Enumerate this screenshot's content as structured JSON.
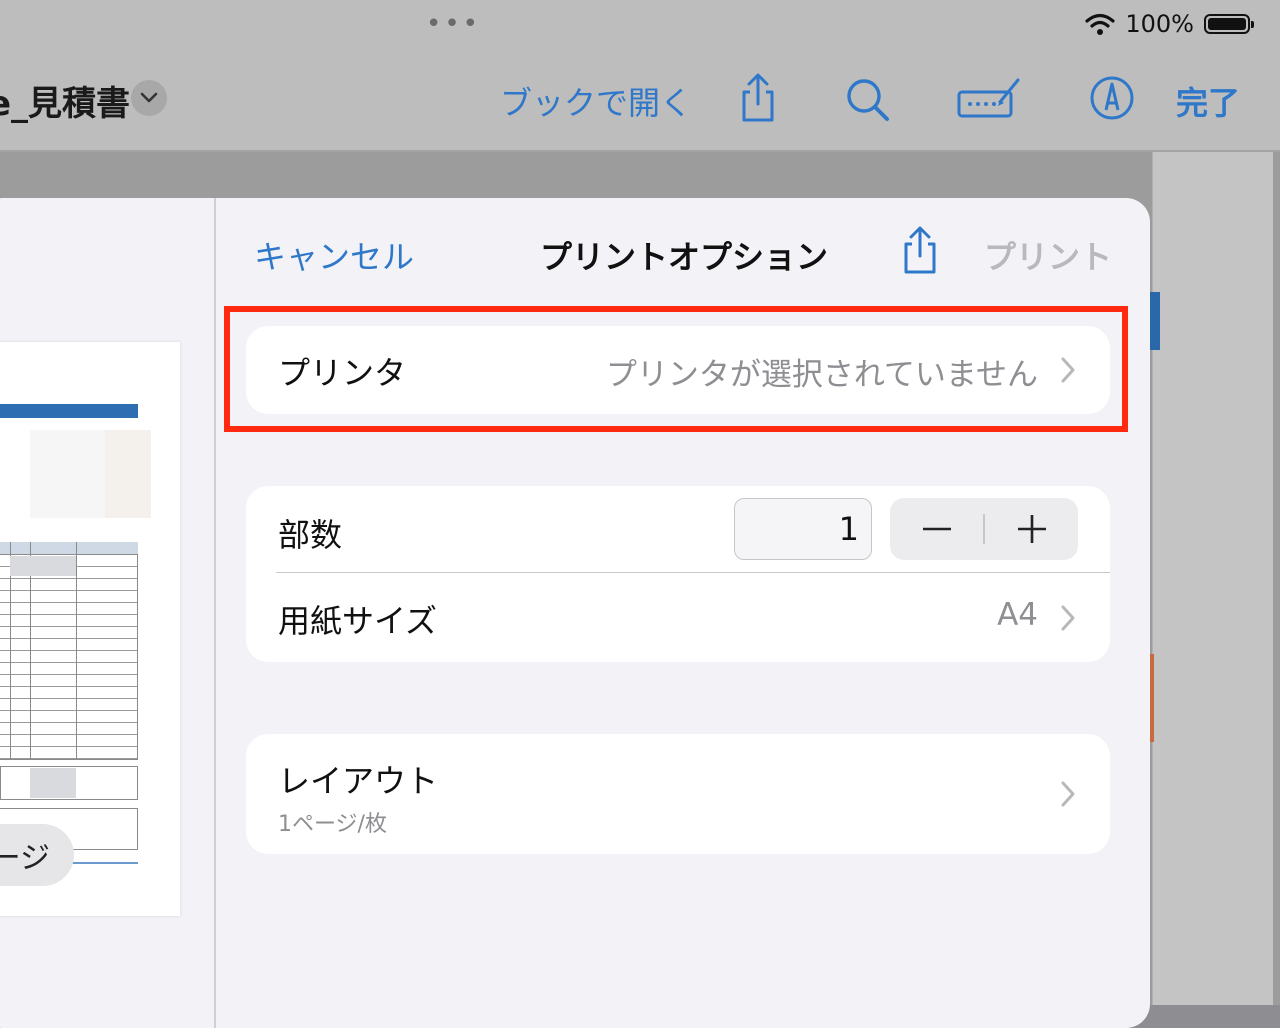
{
  "status_bar": {
    "battery_text": "100%"
  },
  "nav_bar": {
    "doc_title": "e_見積書",
    "open_in_books": "ブックで開く",
    "done": "完了"
  },
  "print_sheet": {
    "cancel": "キャンセル",
    "title": "プリントオプション",
    "print": "プリント",
    "printer": {
      "label": "プリンタ",
      "value": "プリンタが選択されていません"
    },
    "copies": {
      "label": "部数",
      "value": "1"
    },
    "paper_size": {
      "label": "用紙サイズ",
      "value": "A4"
    },
    "layout": {
      "label": "レイアウト",
      "value": "1ページ/枚"
    },
    "preview_page_pill": "ージ"
  },
  "colors": {
    "accent": "#2f78c9",
    "highlight": "#ff2a10",
    "disabled": "#b9b9bd"
  },
  "icons": [
    "wifi-icon",
    "battery-icon",
    "chevron-down-icon",
    "share-icon",
    "search-icon",
    "keyboard-icon",
    "markup-icon",
    "chevron-right-icon",
    "minus-icon",
    "plus-icon"
  ]
}
